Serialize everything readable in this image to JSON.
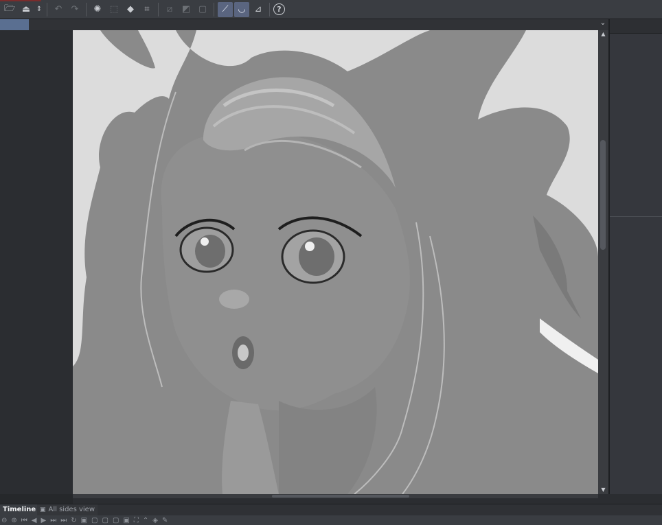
{
  "toolbar": {
    "buttons": [
      {
        "name": "open-file-icon",
        "glyph": "🗁"
      },
      {
        "name": "save-icon",
        "glyph": "⏏"
      },
      {
        "name": "save-dropdown-icon",
        "glyph": "⇕"
      },
      {
        "name": "undo-icon",
        "glyph": "↶"
      },
      {
        "name": "redo-icon",
        "glyph": "↷"
      },
      {
        "name": "loading-spinner-icon",
        "glyph": "✺"
      },
      {
        "name": "selection-layer-icon",
        "glyph": "⬚"
      },
      {
        "name": "fill-bucket-icon",
        "glyph": "◆"
      },
      {
        "name": "crop-icon",
        "glyph": "⌗"
      },
      {
        "name": "clear-selection-icon",
        "glyph": "⧄"
      },
      {
        "name": "invert-selection-icon",
        "glyph": "◩"
      },
      {
        "name": "frame-icon",
        "glyph": "▢"
      },
      {
        "name": "ruler-pen-icon",
        "glyph": "⟋"
      },
      {
        "name": "curve-pen-icon",
        "glyph": "◡"
      },
      {
        "name": "vector-pen-icon",
        "glyph": "⊿"
      },
      {
        "name": "help-icon",
        "glyph": "?"
      }
    ]
  },
  "bottom_tabs": {
    "timeline": "Timeline",
    "all_sides_view": "All sides view"
  },
  "timeline_controls": [
    "⊖",
    "⊕",
    "⏮",
    "◀",
    "▶",
    "⏭",
    "⏭",
    "↻",
    "▣",
    "▢",
    "▢",
    "▢",
    "▣",
    "⛶",
    "⌃",
    "◈",
    "✎"
  ]
}
